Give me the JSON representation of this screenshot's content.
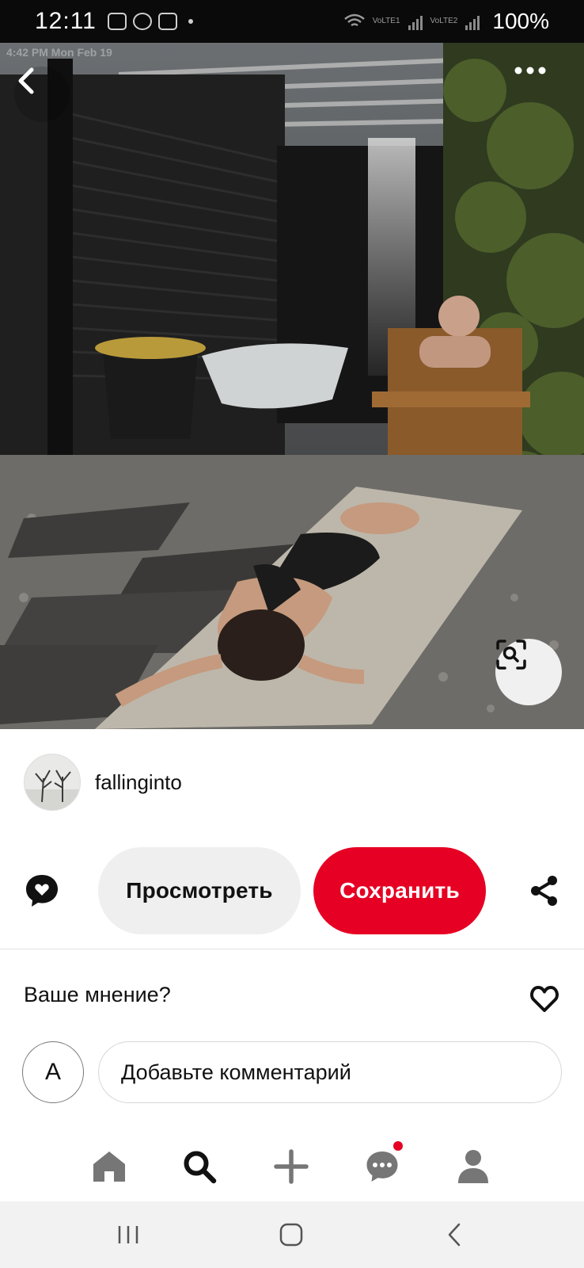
{
  "status_bar": {
    "time": "12:11",
    "network_1": "VoLTE1",
    "network_2": "VoLTE2",
    "battery": "100%"
  },
  "hero": {
    "overlay_text": "4:42 PM   Mon Feb 19",
    "back_icon": "chevron-left-icon",
    "more_icon": "more-horizontal-icon",
    "lens_icon": "visual-search-icon"
  },
  "author": {
    "name": "fallinginto"
  },
  "actions": {
    "comment_icon": "comment-heart-icon",
    "view_label": "Просмотреть",
    "save_label": "Сохранить",
    "share_icon": "share-icon"
  },
  "comments": {
    "heading": "Ваше мнение?",
    "heart_icon": "heart-outline-icon",
    "user_initial": "A",
    "placeholder": "Добавьте комментарий"
  },
  "bottom_nav": [
    {
      "name": "home",
      "icon": "home-icon"
    },
    {
      "name": "search",
      "icon": "search-icon"
    },
    {
      "name": "create",
      "icon": "plus-icon"
    },
    {
      "name": "messages",
      "icon": "chat-icon",
      "has_badge": true
    },
    {
      "name": "profile",
      "icon": "person-icon"
    }
  ],
  "colors": {
    "accent": "#e60023",
    "secondary_button": "#efefef"
  }
}
